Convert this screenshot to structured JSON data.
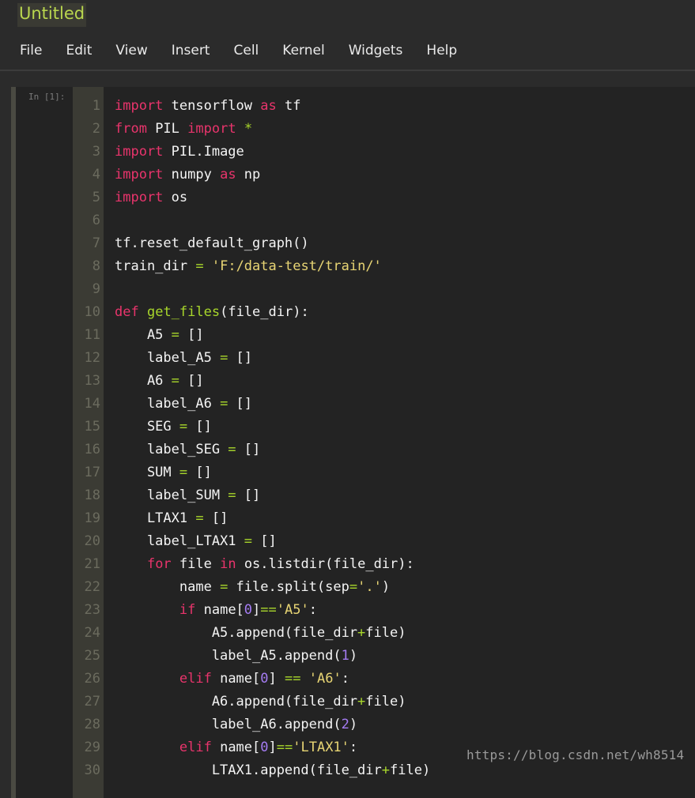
{
  "app": {
    "notebook_title": "Untitled"
  },
  "menu": {
    "items": [
      "File",
      "Edit",
      "View",
      "Insert",
      "Cell",
      "Kernel",
      "Widgets",
      "Help"
    ]
  },
  "cell": {
    "prompt": "In [1]:",
    "lines": [
      {
        "no": "1",
        "tokens": [
          {
            "t": "import",
            "c": "k"
          },
          {
            "t": " tensorflow "
          },
          {
            "t": "as",
            "c": "k"
          },
          {
            "t": " tf"
          }
        ]
      },
      {
        "no": "2",
        "tokens": [
          {
            "t": "from",
            "c": "k"
          },
          {
            "t": " PIL "
          },
          {
            "t": "import",
            "c": "k"
          },
          {
            "t": " "
          },
          {
            "t": "*",
            "c": "o"
          }
        ]
      },
      {
        "no": "3",
        "tokens": [
          {
            "t": "import",
            "c": "k"
          },
          {
            "t": " PIL.Image"
          }
        ]
      },
      {
        "no": "4",
        "tokens": [
          {
            "t": "import",
            "c": "k"
          },
          {
            "t": " numpy "
          },
          {
            "t": "as",
            "c": "k"
          },
          {
            "t": " np"
          }
        ]
      },
      {
        "no": "5",
        "tokens": [
          {
            "t": "import",
            "c": "k"
          },
          {
            "t": " os"
          }
        ]
      },
      {
        "no": "6",
        "tokens": []
      },
      {
        "no": "7",
        "tokens": [
          {
            "t": "tf.reset_default_graph()"
          }
        ]
      },
      {
        "no": "8",
        "tokens": [
          {
            "t": "train_dir "
          },
          {
            "t": "=",
            "c": "o"
          },
          {
            "t": " "
          },
          {
            "t": "'F:/data-test/train/'",
            "c": "s"
          }
        ]
      },
      {
        "no": "9",
        "tokens": []
      },
      {
        "no": "10",
        "tokens": [
          {
            "t": "def",
            "c": "k"
          },
          {
            "t": " "
          },
          {
            "t": "get_files",
            "c": "fn"
          },
          {
            "t": "(file_dir):"
          }
        ]
      },
      {
        "no": "11",
        "tokens": [
          {
            "t": "    A5 "
          },
          {
            "t": "=",
            "c": "o"
          },
          {
            "t": " []"
          }
        ]
      },
      {
        "no": "12",
        "tokens": [
          {
            "t": "    label_A5 "
          },
          {
            "t": "=",
            "c": "o"
          },
          {
            "t": " []"
          }
        ]
      },
      {
        "no": "13",
        "tokens": [
          {
            "t": "    A6 "
          },
          {
            "t": "=",
            "c": "o"
          },
          {
            "t": " []"
          }
        ]
      },
      {
        "no": "14",
        "tokens": [
          {
            "t": "    label_A6 "
          },
          {
            "t": "=",
            "c": "o"
          },
          {
            "t": " []"
          }
        ]
      },
      {
        "no": "15",
        "tokens": [
          {
            "t": "    SEG "
          },
          {
            "t": "=",
            "c": "o"
          },
          {
            "t": " []"
          }
        ]
      },
      {
        "no": "16",
        "tokens": [
          {
            "t": "    label_SEG "
          },
          {
            "t": "=",
            "c": "o"
          },
          {
            "t": " []"
          }
        ]
      },
      {
        "no": "17",
        "tokens": [
          {
            "t": "    SUM "
          },
          {
            "t": "=",
            "c": "o"
          },
          {
            "t": " []"
          }
        ]
      },
      {
        "no": "18",
        "tokens": [
          {
            "t": "    label_SUM "
          },
          {
            "t": "=",
            "c": "o"
          },
          {
            "t": " []"
          }
        ]
      },
      {
        "no": "19",
        "tokens": [
          {
            "t": "    LTAX1 "
          },
          {
            "t": "=",
            "c": "o"
          },
          {
            "t": " []"
          }
        ]
      },
      {
        "no": "20",
        "tokens": [
          {
            "t": "    label_LTAX1 "
          },
          {
            "t": "=",
            "c": "o"
          },
          {
            "t": " []"
          }
        ]
      },
      {
        "no": "21",
        "tokens": [
          {
            "t": "    "
          },
          {
            "t": "for",
            "c": "k"
          },
          {
            "t": " file "
          },
          {
            "t": "in",
            "c": "k"
          },
          {
            "t": " os.listdir(file_dir):"
          }
        ]
      },
      {
        "no": "22",
        "tokens": [
          {
            "t": "        name "
          },
          {
            "t": "=",
            "c": "o"
          },
          {
            "t": " file.split(sep"
          },
          {
            "t": "=",
            "c": "o"
          },
          {
            "t": "'.'",
            "c": "s"
          },
          {
            "t": ")"
          }
        ]
      },
      {
        "no": "23",
        "tokens": [
          {
            "t": "        "
          },
          {
            "t": "if",
            "c": "k"
          },
          {
            "t": " name["
          },
          {
            "t": "0",
            "c": "n"
          },
          {
            "t": "]"
          },
          {
            "t": "==",
            "c": "o"
          },
          {
            "t": "'A5'",
            "c": "s"
          },
          {
            "t": ":"
          }
        ]
      },
      {
        "no": "24",
        "tokens": [
          {
            "t": "            A5.append(file_dir"
          },
          {
            "t": "+",
            "c": "o"
          },
          {
            "t": "file)"
          }
        ]
      },
      {
        "no": "25",
        "tokens": [
          {
            "t": "            label_A5.append("
          },
          {
            "t": "1",
            "c": "n"
          },
          {
            "t": ")"
          }
        ]
      },
      {
        "no": "26",
        "tokens": [
          {
            "t": "        "
          },
          {
            "t": "elif",
            "c": "k"
          },
          {
            "t": " name["
          },
          {
            "t": "0",
            "c": "n"
          },
          {
            "t": "] "
          },
          {
            "t": "==",
            "c": "o"
          },
          {
            "t": " "
          },
          {
            "t": "'A6'",
            "c": "s"
          },
          {
            "t": ":"
          }
        ]
      },
      {
        "no": "27",
        "tokens": [
          {
            "t": "            A6.append(file_dir"
          },
          {
            "t": "+",
            "c": "o"
          },
          {
            "t": "file)"
          }
        ]
      },
      {
        "no": "28",
        "tokens": [
          {
            "t": "            label_A6.append("
          },
          {
            "t": "2",
            "c": "n"
          },
          {
            "t": ")"
          }
        ]
      },
      {
        "no": "29",
        "tokens": [
          {
            "t": "        "
          },
          {
            "t": "elif",
            "c": "k"
          },
          {
            "t": " name["
          },
          {
            "t": "0",
            "c": "n"
          },
          {
            "t": "]"
          },
          {
            "t": "==",
            "c": "o"
          },
          {
            "t": "'LTAX1'",
            "c": "s"
          },
          {
            "t": ":"
          }
        ]
      },
      {
        "no": "30",
        "tokens": [
          {
            "t": "            LTAX1.append(file_dir"
          },
          {
            "t": "+",
            "c": "o"
          },
          {
            "t": "file)"
          }
        ]
      }
    ]
  },
  "watermark": "https://blog.csdn.net/wh8514",
  "colors": {
    "keyword": "#e9346c",
    "function": "#a8d62b",
    "string": "#e8d574",
    "number": "#a57cf3",
    "operator": "#a8d62b",
    "title": "#b9d64e",
    "background": "#2b2b2b"
  }
}
